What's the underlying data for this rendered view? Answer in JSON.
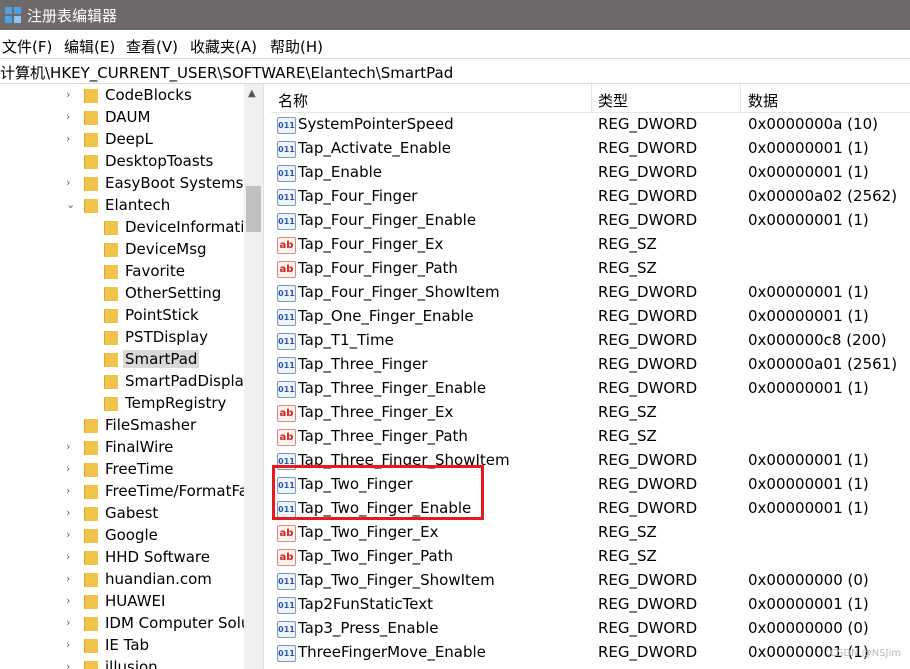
{
  "window": {
    "title": "注册表编辑器"
  },
  "menu": [
    "文件(F)",
    "编辑(E)",
    "查看(V)",
    "收藏夹(A)",
    "帮助(H)"
  ],
  "address": "计算机\\HKEY_CURRENT_USER\\SOFTWARE\\Elantech\\SmartPad",
  "tree": [
    {
      "label": "CodeBlocks",
      "level": 0,
      "chev": "right"
    },
    {
      "label": "DAUM",
      "level": 0,
      "chev": "right"
    },
    {
      "label": "DeepL",
      "level": 0,
      "chev": "right"
    },
    {
      "label": "DesktopToasts",
      "level": 0,
      "chev": "none"
    },
    {
      "label": "EasyBoot Systems",
      "level": 0,
      "chev": "right"
    },
    {
      "label": "Elantech",
      "level": 0,
      "chev": "down"
    },
    {
      "label": "DeviceInformati",
      "level": 1,
      "chev": "none"
    },
    {
      "label": "DeviceMsg",
      "level": 1,
      "chev": "none"
    },
    {
      "label": "Favorite",
      "level": 1,
      "chev": "none"
    },
    {
      "label": "OtherSetting",
      "level": 1,
      "chev": "none"
    },
    {
      "label": "PointStick",
      "level": 1,
      "chev": "none"
    },
    {
      "label": "PSTDisplay",
      "level": 1,
      "chev": "none"
    },
    {
      "label": "SmartPad",
      "level": 1,
      "chev": "none",
      "selected": true
    },
    {
      "label": "SmartPadDisplay",
      "level": 1,
      "chev": "none"
    },
    {
      "label": "TempRegistry",
      "level": 1,
      "chev": "none"
    },
    {
      "label": "FileSmasher",
      "level": 0,
      "chev": "none"
    },
    {
      "label": "FinalWire",
      "level": 0,
      "chev": "right"
    },
    {
      "label": "FreeTime",
      "level": 0,
      "chev": "right"
    },
    {
      "label": "FreeTime/FormatFa",
      "level": 0,
      "chev": "right"
    },
    {
      "label": "Gabest",
      "level": 0,
      "chev": "right"
    },
    {
      "label": "Google",
      "level": 0,
      "chev": "right"
    },
    {
      "label": "HHD Software",
      "level": 0,
      "chev": "right"
    },
    {
      "label": "huandian.com",
      "level": 0,
      "chev": "right"
    },
    {
      "label": "HUAWEI",
      "level": 0,
      "chev": "right"
    },
    {
      "label": "IDM Computer Solu",
      "level": 0,
      "chev": "right"
    },
    {
      "label": "IE Tab",
      "level": 0,
      "chev": "right"
    },
    {
      "label": "illusion",
      "level": 0,
      "chev": "right"
    }
  ],
  "columns": {
    "name": "名称",
    "type": "类型",
    "data": "数据"
  },
  "values": [
    {
      "name": "SystemPointerSpeed",
      "type": "REG_DWORD",
      "data": "0x0000000a (10)",
      "icon": "dword"
    },
    {
      "name": "Tap_Activate_Enable",
      "type": "REG_DWORD",
      "data": "0x00000001 (1)",
      "icon": "dword"
    },
    {
      "name": "Tap_Enable",
      "type": "REG_DWORD",
      "data": "0x00000001 (1)",
      "icon": "dword"
    },
    {
      "name": "Tap_Four_Finger",
      "type": "REG_DWORD",
      "data": "0x00000a02 (2562)",
      "icon": "dword"
    },
    {
      "name": "Tap_Four_Finger_Enable",
      "type": "REG_DWORD",
      "data": "0x00000001 (1)",
      "icon": "dword"
    },
    {
      "name": "Tap_Four_Finger_Ex",
      "type": "REG_SZ",
      "data": "",
      "icon": "sz"
    },
    {
      "name": "Tap_Four_Finger_Path",
      "type": "REG_SZ",
      "data": "",
      "icon": "sz"
    },
    {
      "name": "Tap_Four_Finger_ShowItem",
      "type": "REG_DWORD",
      "data": "0x00000001 (1)",
      "icon": "dword"
    },
    {
      "name": "Tap_One_Finger_Enable",
      "type": "REG_DWORD",
      "data": "0x00000001 (1)",
      "icon": "dword"
    },
    {
      "name": "Tap_T1_Time",
      "type": "REG_DWORD",
      "data": "0x000000c8 (200)",
      "icon": "dword"
    },
    {
      "name": "Tap_Three_Finger",
      "type": "REG_DWORD",
      "data": "0x00000a01 (2561)",
      "icon": "dword"
    },
    {
      "name": "Tap_Three_Finger_Enable",
      "type": "REG_DWORD",
      "data": "0x00000001 (1)",
      "icon": "dword"
    },
    {
      "name": "Tap_Three_Finger_Ex",
      "type": "REG_SZ",
      "data": "",
      "icon": "sz"
    },
    {
      "name": "Tap_Three_Finger_Path",
      "type": "REG_SZ",
      "data": "",
      "icon": "sz"
    },
    {
      "name": "Tap_Three_Finger_ShowItem",
      "type": "REG_DWORD",
      "data": "0x00000001 (1)",
      "icon": "dword"
    },
    {
      "name": "Tap_Two_Finger",
      "type": "REG_DWORD",
      "data": "0x00000001 (1)",
      "icon": "dword"
    },
    {
      "name": "Tap_Two_Finger_Enable",
      "type": "REG_DWORD",
      "data": "0x00000001 (1)",
      "icon": "dword"
    },
    {
      "name": "Tap_Two_Finger_Ex",
      "type": "REG_SZ",
      "data": "",
      "icon": "sz"
    },
    {
      "name": "Tap_Two_Finger_Path",
      "type": "REG_SZ",
      "data": "",
      "icon": "sz"
    },
    {
      "name": "Tap_Two_Finger_ShowItem",
      "type": "REG_DWORD",
      "data": "0x00000000 (0)",
      "icon": "dword"
    },
    {
      "name": "Tap2FunStaticText",
      "type": "REG_DWORD",
      "data": "0x00000001 (1)",
      "icon": "dword"
    },
    {
      "name": "Tap3_Press_Enable",
      "type": "REG_DWORD",
      "data": "0x00000000 (0)",
      "icon": "dword"
    },
    {
      "name": "ThreeFingerMove_Enable",
      "type": "REG_DWORD",
      "data": "0x00000001 (1)",
      "icon": "dword"
    }
  ],
  "watermark": "CSDN @NSJim"
}
